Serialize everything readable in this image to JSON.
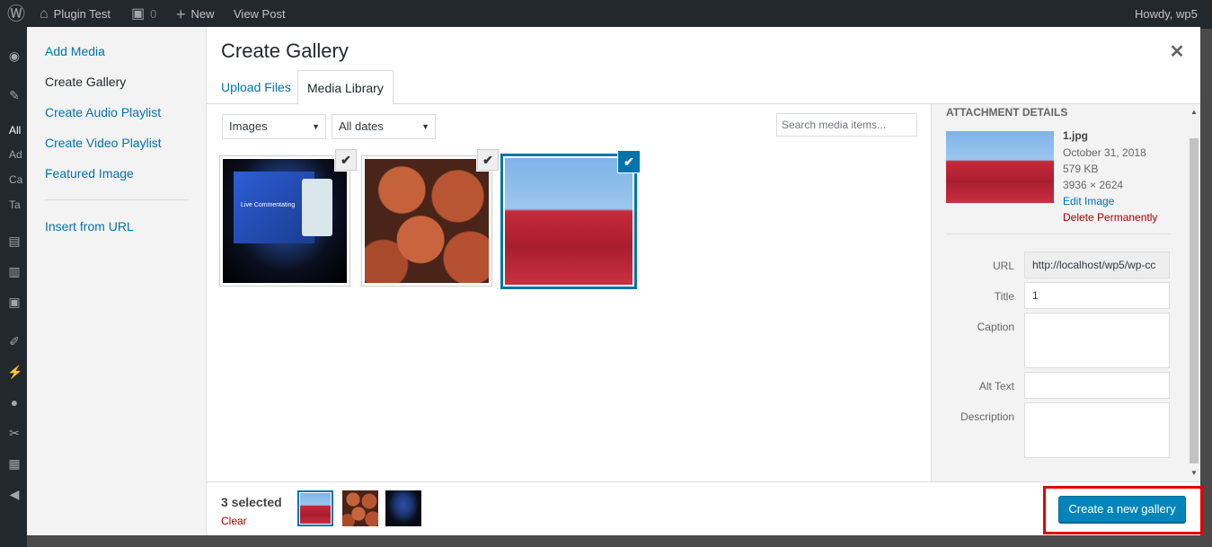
{
  "admin_bar": {
    "site_name": "Plugin Test",
    "comments_count": "0",
    "new_label": "New",
    "view_post_label": "View Post",
    "howdy": "Howdy, wp5"
  },
  "admin_menu_fragments": [
    "All",
    "Ad",
    "Ca",
    "Ta"
  ],
  "modal": {
    "title": "Create Gallery",
    "menu": {
      "items": [
        "Add Media",
        "Create Gallery",
        "Create Audio Playlist",
        "Create Video Playlist",
        "Featured Image"
      ],
      "active": "Create Gallery",
      "insert_from_url": "Insert from URL"
    },
    "tabs": [
      "Upload Files",
      "Media Library"
    ],
    "active_tab": "Media Library",
    "filters": {
      "type": "Images",
      "date": "All dates"
    },
    "search": {
      "placeholder": "Search media items..."
    },
    "attachments": [
      {
        "icon": "live-commentating-stage-image",
        "caption_text": "Live Commentating",
        "selected": false
      },
      {
        "icon": "pumpkins-image",
        "selected": false
      },
      {
        "icon": "red-field-image",
        "selected": true
      }
    ],
    "details": {
      "heading": "Attachment Details",
      "filename": "1.jpg",
      "date": "October 31, 2018",
      "filesize": "579 KB",
      "dimensions": "3936 × 2624",
      "edit_link": "Edit Image",
      "delete_link": "Delete Permanently",
      "labels": {
        "url": "URL",
        "title": "Title",
        "caption": "Caption",
        "alt": "Alt Text",
        "description": "Description"
      },
      "values": {
        "url": "http://localhost/wp5/wp-cc",
        "title": "1",
        "caption": "",
        "alt": "",
        "description": ""
      }
    },
    "selection": {
      "count": "3 selected",
      "clear": "Clear"
    },
    "primary_button": "Create a new gallery"
  },
  "colors": {
    "accent": "#0073aa",
    "button": "#0085ba",
    "danger": "#a00",
    "highlight": "#e00000"
  }
}
